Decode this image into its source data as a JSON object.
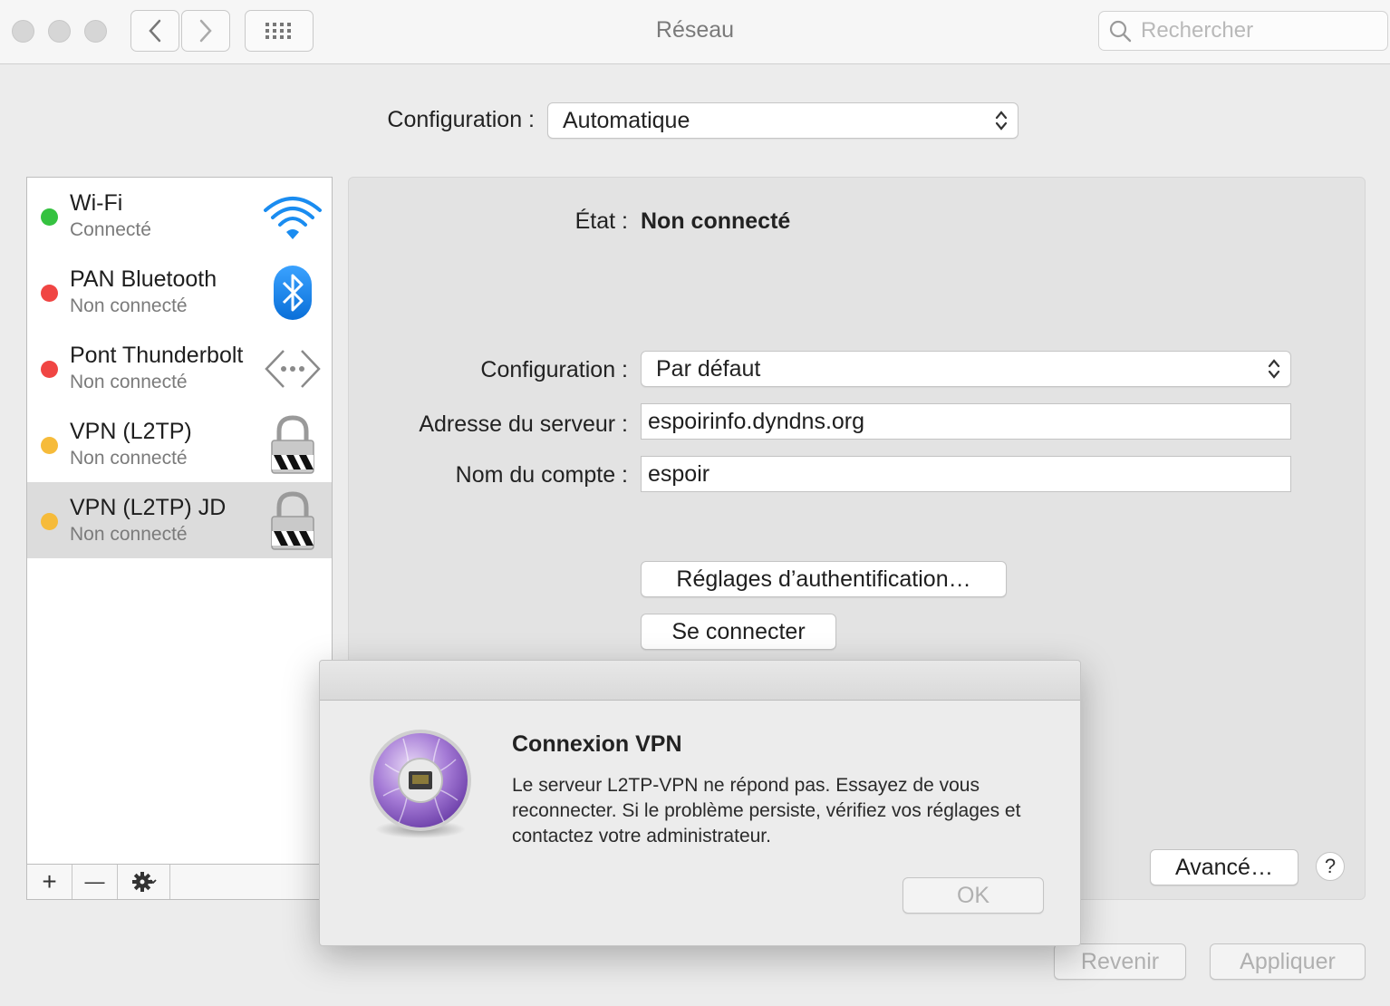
{
  "window": {
    "title": "Réseau"
  },
  "toolbar": {
    "back_label": "‹",
    "forward_label": "›",
    "search_placeholder": "Rechercher"
  },
  "location": {
    "label": "Configuration :",
    "value": "Automatique"
  },
  "services": [
    {
      "name": "Wi-Fi",
      "status": "Connecté",
      "status_color": "#35c240",
      "icon": "wifi-icon",
      "selected": false
    },
    {
      "name": "PAN Bluetooth",
      "status": "Non connecté",
      "status_color": "#f04543",
      "icon": "bluetooth-icon",
      "selected": false
    },
    {
      "name": "Pont Thunderbolt",
      "status": "Non connecté",
      "status_color": "#f04543",
      "icon": "thunderbolt-bridge-icon",
      "selected": false
    },
    {
      "name": "VPN (L2TP)",
      "status": "Non connecté",
      "status_color": "#f6bb3a",
      "icon": "lock-icon",
      "selected": false
    },
    {
      "name": "VPN (L2TP) JD",
      "status": "Non connecté",
      "status_color": "#f6bb3a",
      "icon": "lock-icon",
      "selected": true
    }
  ],
  "sidebar_actions": {
    "add": "+",
    "remove": "—",
    "gear": "gear-icon"
  },
  "detail": {
    "state_label": "État :",
    "state_value": "Non connecté",
    "config_label": "Configuration :",
    "config_value": "Par défaut",
    "server_label": "Adresse du serveur :",
    "server_value": "espoirinfo.dyndns.org",
    "account_label": "Nom du compte :",
    "account_value": "espoir",
    "auth_button": "Réglages d’authentification…",
    "connect_button": "Se connecter",
    "advanced_button": "Avancé…",
    "help_button": "?"
  },
  "footer": {
    "revert": "Revenir",
    "apply": "Appliquer"
  },
  "dialog": {
    "title": "Connexion VPN",
    "message": "Le serveur L2TP-VPN ne répond pas. Essayez de vous reconnecter. Si le problème persiste, vérifiez vos réglages et contactez votre administrateur.",
    "ok": "OK",
    "icon": "network-connect-icon"
  },
  "colors": {
    "accent": "#1a8cf0",
    "window_bg": "#ececec"
  }
}
